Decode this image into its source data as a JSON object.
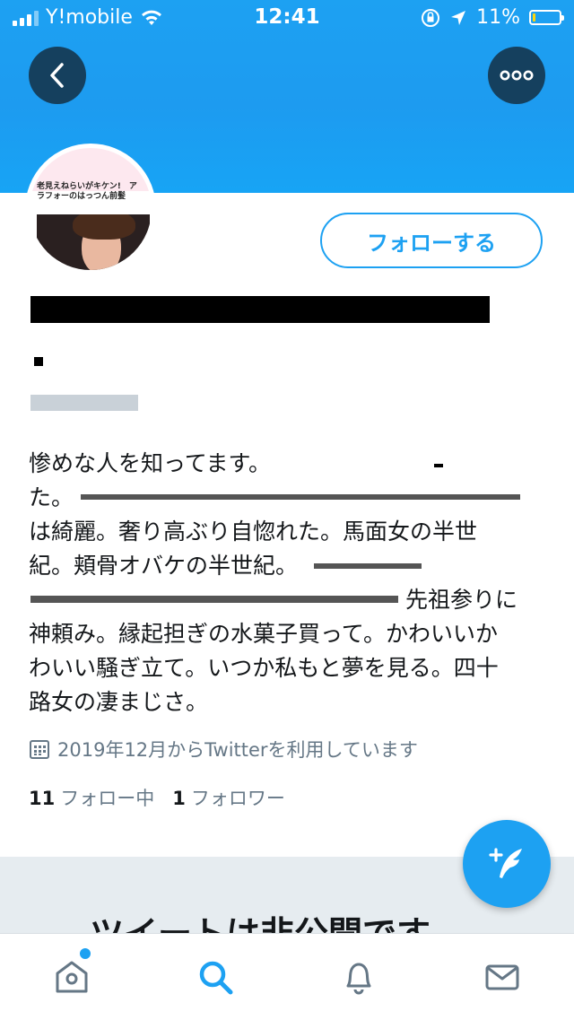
{
  "status_bar": {
    "carrier": "Y!mobile",
    "time": "12:41",
    "battery_percent": "11%",
    "battery_level": 0.11,
    "battery_color": "#ffd60a"
  },
  "header": {
    "accent_color": "#1da1f2",
    "back_icon": "chevron-left-icon",
    "more_icon": "more-horizontal-icon"
  },
  "profile": {
    "avatar_banner_text": "老見えねらいがキケン!　アラフォーのはっつん前髪",
    "follow_button_label": "フォローする",
    "bio_lines": [
      "惨めな人を知ってます。",
      "た。",
      "は綺麗。奢り高ぶり自惚れた。馬面女の半世",
      "紀。頬骨オバケの半世紀。",
      "先祖参りに",
      "神頼み。縁起担ぎの水菓子買って。かわいいか",
      "わいい騒ぎ立て。いつか私もと夢を見る。四十",
      "路女の凄まじさ。"
    ],
    "joined_text": "2019年12月からTwitterを利用しています",
    "following_count": "11",
    "following_label": "フォロー中",
    "followers_count": "1",
    "followers_label": "フォロワー"
  },
  "private_notice": {
    "title": "ツイートは非公開です"
  },
  "fab": {
    "icon": "compose-tweet-icon"
  },
  "tab_bar": {
    "items": [
      {
        "icon": "home-icon",
        "has_badge": true
      },
      {
        "icon": "search-icon",
        "active": true
      },
      {
        "icon": "bell-icon"
      },
      {
        "icon": "mail-icon"
      }
    ]
  }
}
